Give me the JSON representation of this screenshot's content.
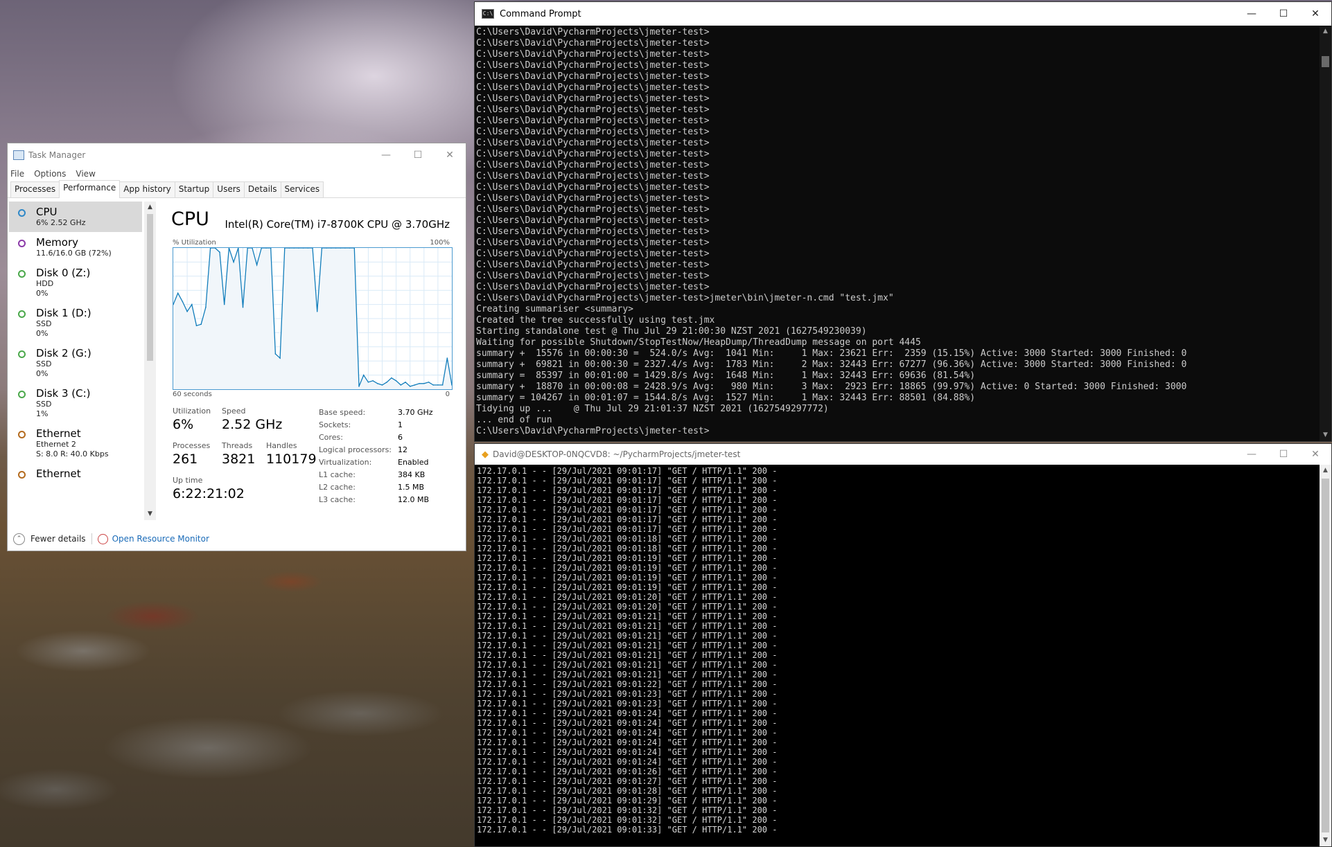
{
  "desktop": {
    "wallpaper": "mountain landscape"
  },
  "cmd": {
    "title": "Command Prompt",
    "lines": [
      "C:\\Users\\David\\PycharmProjects\\jmeter-test>",
      "C:\\Users\\David\\PycharmProjects\\jmeter-test>",
      "C:\\Users\\David\\PycharmProjects\\jmeter-test>",
      "C:\\Users\\David\\PycharmProjects\\jmeter-test>",
      "C:\\Users\\David\\PycharmProjects\\jmeter-test>",
      "C:\\Users\\David\\PycharmProjects\\jmeter-test>",
      "C:\\Users\\David\\PycharmProjects\\jmeter-test>",
      "C:\\Users\\David\\PycharmProjects\\jmeter-test>",
      "C:\\Users\\David\\PycharmProjects\\jmeter-test>",
      "C:\\Users\\David\\PycharmProjects\\jmeter-test>",
      "C:\\Users\\David\\PycharmProjects\\jmeter-test>",
      "C:\\Users\\David\\PycharmProjects\\jmeter-test>",
      "C:\\Users\\David\\PycharmProjects\\jmeter-test>",
      "C:\\Users\\David\\PycharmProjects\\jmeter-test>",
      "C:\\Users\\David\\PycharmProjects\\jmeter-test>",
      "C:\\Users\\David\\PycharmProjects\\jmeter-test>",
      "C:\\Users\\David\\PycharmProjects\\jmeter-test>",
      "C:\\Users\\David\\PycharmProjects\\jmeter-test>",
      "C:\\Users\\David\\PycharmProjects\\jmeter-test>",
      "C:\\Users\\David\\PycharmProjects\\jmeter-test>",
      "C:\\Users\\David\\PycharmProjects\\jmeter-test>",
      "C:\\Users\\David\\PycharmProjects\\jmeter-test>",
      "C:\\Users\\David\\PycharmProjects\\jmeter-test>",
      "C:\\Users\\David\\PycharmProjects\\jmeter-test>",
      "C:\\Users\\David\\PycharmProjects\\jmeter-test>jmeter\\bin\\jmeter-n.cmd \"test.jmx\"",
      "Creating summariser <summary>",
      "Created the tree successfully using test.jmx",
      "Starting standalone test @ Thu Jul 29 21:00:30 NZST 2021 (1627549230039)",
      "Waiting for possible Shutdown/StopTestNow/HeapDump/ThreadDump message on port 4445",
      "summary +  15576 in 00:00:30 =  524.0/s Avg:  1041 Min:     1 Max: 23621 Err:  2359 (15.15%) Active: 3000 Started: 3000 Finished: 0",
      "summary +  69821 in 00:00:30 = 2327.4/s Avg:  1783 Min:     2 Max: 32443 Err: 67277 (96.36%) Active: 3000 Started: 3000 Finished: 0",
      "summary =  85397 in 00:01:00 = 1429.8/s Avg:  1648 Min:     1 Max: 32443 Err: 69636 (81.54%)",
      "summary +  18870 in 00:00:08 = 2428.9/s Avg:   980 Min:     3 Max:  2923 Err: 18865 (99.97%) Active: 0 Started: 3000 Finished: 3000",
      "summary = 104267 in 00:01:07 = 1544.8/s Avg:  1527 Min:     1 Max: 32443 Err: 88501 (84.88%)",
      "Tidying up ...    @ Thu Jul 29 21:01:37 NZST 2021 (1627549297772)",
      "... end of run",
      "C:\\Users\\David\\PycharmProjects\\jmeter-test>"
    ]
  },
  "bash": {
    "title": "David@DESKTOP-0NQCVD8: ~/PycharmProjects/jmeter-test",
    "lines": [
      "172.17.0.1 - - [29/Jul/2021 09:01:17] \"GET / HTTP/1.1\" 200 -",
      "172.17.0.1 - - [29/Jul/2021 09:01:17] \"GET / HTTP/1.1\" 200 -",
      "172.17.0.1 - - [29/Jul/2021 09:01:17] \"GET / HTTP/1.1\" 200 -",
      "172.17.0.1 - - [29/Jul/2021 09:01:17] \"GET / HTTP/1.1\" 200 -",
      "172.17.0.1 - - [29/Jul/2021 09:01:17] \"GET / HTTP/1.1\" 200 -",
      "172.17.0.1 - - [29/Jul/2021 09:01:17] \"GET / HTTP/1.1\" 200 -",
      "172.17.0.1 - - [29/Jul/2021 09:01:17] \"GET / HTTP/1.1\" 200 -",
      "172.17.0.1 - - [29/Jul/2021 09:01:18] \"GET / HTTP/1.1\" 200 -",
      "172.17.0.1 - - [29/Jul/2021 09:01:18] \"GET / HTTP/1.1\" 200 -",
      "172.17.0.1 - - [29/Jul/2021 09:01:19] \"GET / HTTP/1.1\" 200 -",
      "172.17.0.1 - - [29/Jul/2021 09:01:19] \"GET / HTTP/1.1\" 200 -",
      "172.17.0.1 - - [29/Jul/2021 09:01:19] \"GET / HTTP/1.1\" 200 -",
      "172.17.0.1 - - [29/Jul/2021 09:01:19] \"GET / HTTP/1.1\" 200 -",
      "172.17.0.1 - - [29/Jul/2021 09:01:20] \"GET / HTTP/1.1\" 200 -",
      "172.17.0.1 - - [29/Jul/2021 09:01:20] \"GET / HTTP/1.1\" 200 -",
      "172.17.0.1 - - [29/Jul/2021 09:01:21] \"GET / HTTP/1.1\" 200 -",
      "172.17.0.1 - - [29/Jul/2021 09:01:21] \"GET / HTTP/1.1\" 200 -",
      "172.17.0.1 - - [29/Jul/2021 09:01:21] \"GET / HTTP/1.1\" 200 -",
      "172.17.0.1 - - [29/Jul/2021 09:01:21] \"GET / HTTP/1.1\" 200 -",
      "172.17.0.1 - - [29/Jul/2021 09:01:21] \"GET / HTTP/1.1\" 200 -",
      "172.17.0.1 - - [29/Jul/2021 09:01:21] \"GET / HTTP/1.1\" 200 -",
      "172.17.0.1 - - [29/Jul/2021 09:01:21] \"GET / HTTP/1.1\" 200 -",
      "172.17.0.1 - - [29/Jul/2021 09:01:22] \"GET / HTTP/1.1\" 200 -",
      "172.17.0.1 - - [29/Jul/2021 09:01:23] \"GET / HTTP/1.1\" 200 -",
      "172.17.0.1 - - [29/Jul/2021 09:01:23] \"GET / HTTP/1.1\" 200 -",
      "172.17.0.1 - - [29/Jul/2021 09:01:24] \"GET / HTTP/1.1\" 200 -",
      "172.17.0.1 - - [29/Jul/2021 09:01:24] \"GET / HTTP/1.1\" 200 -",
      "172.17.0.1 - - [29/Jul/2021 09:01:24] \"GET / HTTP/1.1\" 200 -",
      "172.17.0.1 - - [29/Jul/2021 09:01:24] \"GET / HTTP/1.1\" 200 -",
      "172.17.0.1 - - [29/Jul/2021 09:01:24] \"GET / HTTP/1.1\" 200 -",
      "172.17.0.1 - - [29/Jul/2021 09:01:24] \"GET / HTTP/1.1\" 200 -",
      "172.17.0.1 - - [29/Jul/2021 09:01:26] \"GET / HTTP/1.1\" 200 -",
      "172.17.0.1 - - [29/Jul/2021 09:01:27] \"GET / HTTP/1.1\" 200 -",
      "172.17.0.1 - - [29/Jul/2021 09:01:28] \"GET / HTTP/1.1\" 200 -",
      "172.17.0.1 - - [29/Jul/2021 09:01:29] \"GET / HTTP/1.1\" 200 -",
      "172.17.0.1 - - [29/Jul/2021 09:01:32] \"GET / HTTP/1.1\" 200 -",
      "172.17.0.1 - - [29/Jul/2021 09:01:32] \"GET / HTTP/1.1\" 200 -",
      "172.17.0.1 - - [29/Jul/2021 09:01:33] \"GET / HTTP/1.1\" 200 -"
    ]
  },
  "taskmanager": {
    "title": "Task Manager",
    "menu": [
      "File",
      "Options",
      "View"
    ],
    "tabs": [
      "Processes",
      "Performance",
      "App history",
      "Startup",
      "Users",
      "Details",
      "Services"
    ],
    "active_tab": "Performance",
    "sidebar": [
      {
        "name": "CPU",
        "sub1": "6% 2.52 GHz",
        "sub2": "",
        "sub3": "",
        "color": "#2f88c8"
      },
      {
        "name": "Memory",
        "sub1": "11.6/16.0 GB (72%)",
        "sub2": "",
        "sub3": "",
        "color": "#8b3aa8"
      },
      {
        "name": "Disk 0 (Z:)",
        "sub1": "HDD",
        "sub2": "0%",
        "sub3": "",
        "color": "#4aa84a"
      },
      {
        "name": "Disk 1 (D:)",
        "sub1": "SSD",
        "sub2": "0%",
        "sub3": "",
        "color": "#4aa84a"
      },
      {
        "name": "Disk 2 (G:)",
        "sub1": "SSD",
        "sub2": "0%",
        "sub3": "",
        "color": "#4aa84a"
      },
      {
        "name": "Disk 3 (C:)",
        "sub1": "SSD",
        "sub2": "1%",
        "sub3": "",
        "color": "#4aa84a"
      },
      {
        "name": "Ethernet",
        "sub1": "Ethernet 2",
        "sub2": "S: 8.0  R: 40.0 Kbps",
        "sub3": "",
        "color": "#b46b1e"
      },
      {
        "name": "Ethernet",
        "sub1": "",
        "sub2": "",
        "sub3": "",
        "color": "#b46b1e"
      }
    ],
    "cpu": {
      "title": "CPU",
      "model": "Intel(R) Core(TM) i7-8700K CPU @ 3.70GHz",
      "util_label": "% Utilization",
      "util_max": "100%",
      "axis_left": "60 seconds",
      "axis_right": "0",
      "utilization_label": "Utilization",
      "utilization": "6%",
      "speed_label": "Speed",
      "speed": "2.52 GHz",
      "processes_label": "Processes",
      "processes": "261",
      "threads_label": "Threads",
      "threads": "3821",
      "handles_label": "Handles",
      "handles": "110179",
      "uptime_label": "Up time",
      "uptime": "6:22:21:02",
      "specs": [
        {
          "k": "Base speed:",
          "v": "3.70 GHz"
        },
        {
          "k": "Sockets:",
          "v": "1"
        },
        {
          "k": "Cores:",
          "v": "6"
        },
        {
          "k": "Logical processors:",
          "v": "12"
        },
        {
          "k": "Virtualization:",
          "v": "Enabled"
        },
        {
          "k": "L1 cache:",
          "v": "384 KB"
        },
        {
          "k": "L2 cache:",
          "v": "1.5 MB"
        },
        {
          "k": "L3 cache:",
          "v": "12.0 MB"
        }
      ]
    },
    "footer": {
      "fewer": "Fewer details",
      "monitor": "Open Resource Monitor"
    }
  },
  "chart_data": {
    "type": "area",
    "ylim": [
      0,
      100
    ],
    "x": [
      60,
      59,
      58,
      57,
      56,
      55,
      54,
      53,
      52,
      51,
      50,
      49,
      48,
      47,
      46,
      45,
      44,
      43,
      42,
      41,
      40,
      39,
      38,
      37,
      36,
      35,
      34,
      33,
      32,
      31,
      30,
      29,
      28,
      27,
      26,
      25,
      24,
      23,
      22,
      21,
      20,
      19,
      18,
      17,
      16,
      15,
      14,
      13,
      12,
      11,
      10,
      9,
      8,
      7,
      6,
      5,
      4,
      3,
      2,
      1,
      0
    ],
    "values": [
      60,
      68,
      62,
      55,
      60,
      45,
      46,
      58,
      100,
      100,
      97,
      60,
      100,
      90,
      100,
      58,
      100,
      100,
      88,
      100,
      100,
      100,
      25,
      22,
      100,
      100,
      100,
      100,
      100,
      100,
      100,
      55,
      100,
      100,
      100,
      100,
      100,
      100,
      100,
      100,
      2,
      10,
      5,
      6,
      4,
      3,
      5,
      8,
      6,
      3,
      5,
      2,
      3,
      4,
      4,
      5,
      3,
      3,
      3,
      22,
      3
    ],
    "color": "#117dbb"
  }
}
